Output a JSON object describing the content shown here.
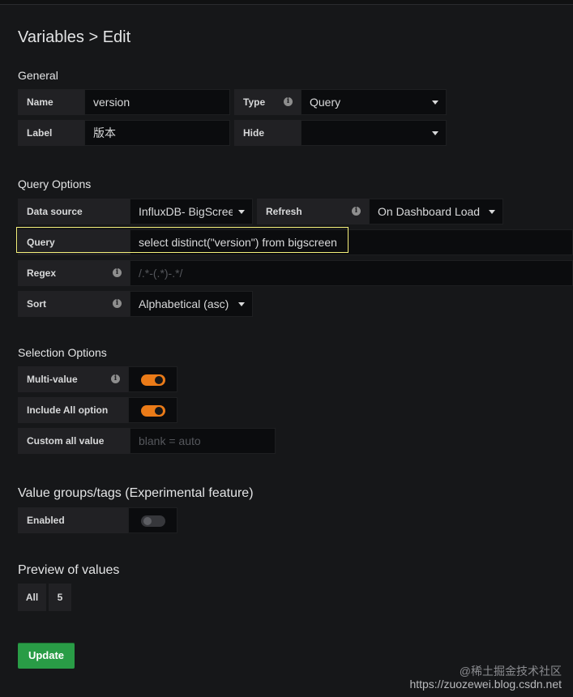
{
  "page": {
    "title": "Variables > Edit"
  },
  "general": {
    "title": "General",
    "name_label": "Name",
    "name_value": "version",
    "type_label": "Type",
    "type_value": "Query",
    "label_label": "Label",
    "label_value": "版本",
    "hide_label": "Hide",
    "hide_value": ""
  },
  "query_options": {
    "title": "Query Options",
    "datasource_label": "Data source",
    "datasource_value": "InfluxDB- BigScreen",
    "refresh_label": "Refresh",
    "refresh_value": "On Dashboard Load",
    "query_label": "Query",
    "query_value": "select distinct(\"version\") from bigscreen",
    "regex_label": "Regex",
    "regex_placeholder": "/.*-(.*)-.*/",
    "sort_label": "Sort",
    "sort_value": "Alphabetical (asc)"
  },
  "selection_options": {
    "title": "Selection Options",
    "multi_value_label": "Multi-value",
    "multi_value_on": true,
    "include_all_label": "Include All option",
    "include_all_on": true,
    "custom_all_label": "Custom all value",
    "custom_all_placeholder": "blank = auto"
  },
  "value_groups": {
    "title": "Value groups/tags (Experimental feature)",
    "enabled_label": "Enabled",
    "enabled_on": false
  },
  "preview": {
    "title": "Preview of values",
    "values": [
      "All",
      "5"
    ]
  },
  "actions": {
    "update_label": "Update"
  },
  "watermark": {
    "line1": "@稀土掘金技术社区",
    "line2": "https://zuozewei.blog.csdn.net"
  },
  "colors": {
    "accent_toggle": "#eb7b18",
    "update_button": "#299c46",
    "focus_outline": "#f5f07a"
  }
}
